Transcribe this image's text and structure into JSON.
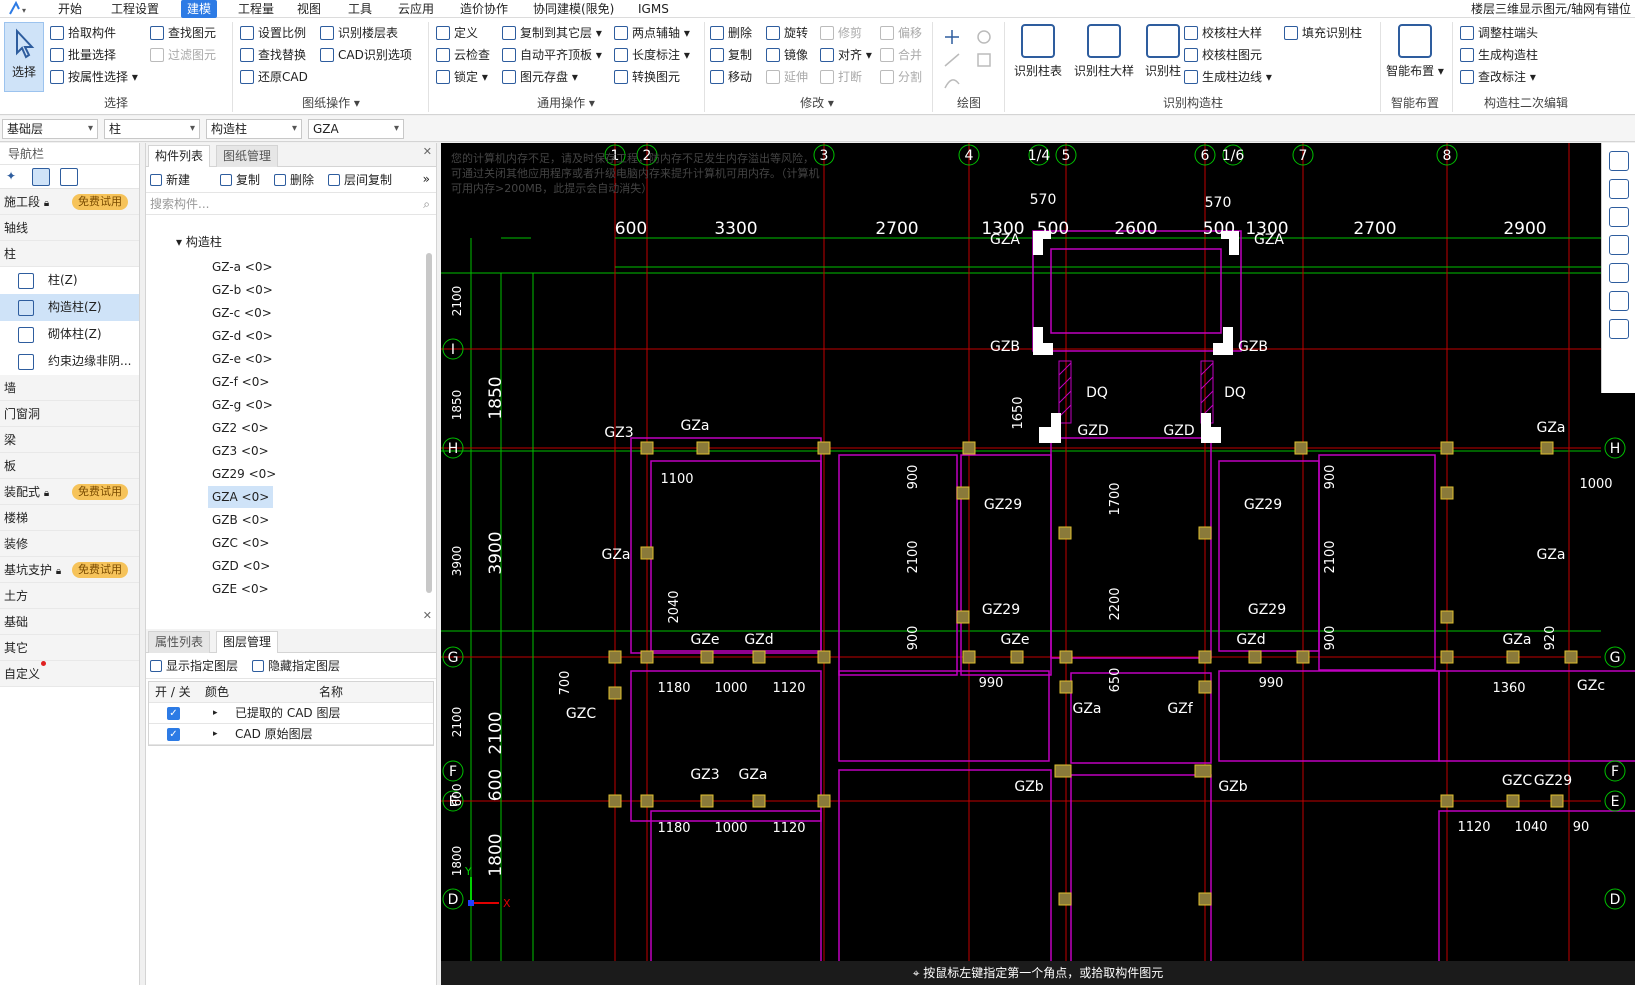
{
  "menu": {
    "items": [
      "开始",
      "工程设置",
      "建模",
      "工程量",
      "视图",
      "工具",
      "云应用",
      "造价协作",
      "协同建模(限免)",
      "IGMS"
    ],
    "active": "建模",
    "right_text": "楼层三维显示图元/轴网有错位"
  },
  "ribbon": {
    "select_big": "选择",
    "select_col1": [
      "拾取构件",
      "批量选择",
      "按属性选择"
    ],
    "select_col2": [
      "查找图元",
      "过滤图元"
    ],
    "select_label": "选择",
    "drawing_col1": [
      "设置比例",
      "查找替换",
      "还原CAD"
    ],
    "drawing_col2": [
      "识别楼层表",
      "CAD识别选项"
    ],
    "drawing_label": "图纸操作",
    "common_col1": [
      "定义",
      "云检查",
      "锁定"
    ],
    "common_col2": [
      "复制到其它层",
      "自动平齐顶板",
      "图元存盘"
    ],
    "common_col3": [
      "两点辅轴",
      "长度标注",
      "转换图元"
    ],
    "common_label": "通用操作",
    "modify_col1": [
      "删除",
      "复制",
      "移动"
    ],
    "modify_col2": [
      "旋转",
      "镜像",
      "延伸"
    ],
    "modify_col3": [
      "修剪",
      "对齐",
      "打断"
    ],
    "modify_col4": [
      "偏移",
      "合并",
      "分割"
    ],
    "modify_label": "修改",
    "draw_label": "绘图",
    "recognize_bigs": [
      "识别柱表",
      "识别柱大样",
      "识别柱"
    ],
    "recognize_col": [
      "校核柱大样",
      "校核柱图元",
      "生成柱边线"
    ],
    "recognize_col2": [
      "填充识别柱"
    ],
    "recognize_label": "识别构造柱",
    "smart_big": "智能布置",
    "smart_label": "智能布置",
    "edit_col": [
      "调整柱端头",
      "生成构造柱",
      "查改标注"
    ],
    "edit_label": "构造柱二次编辑"
  },
  "selectors": [
    "基础层",
    "柱",
    "构造柱",
    "GZA"
  ],
  "nav": {
    "title": "导航栏",
    "categories": [
      {
        "label": "施工段",
        "badge": "免费试用"
      },
      {
        "label": "轴线"
      },
      {
        "label": "柱"
      }
    ],
    "column_items": [
      "柱(Z)",
      "构造柱(Z)",
      "砌体柱(Z)",
      "约束边缘非阴..."
    ],
    "selected_item": "构造柱(Z)",
    "more_categories": [
      {
        "label": "墙"
      },
      {
        "label": "门窗洞"
      },
      {
        "label": "梁"
      },
      {
        "label": "板"
      },
      {
        "label": "装配式",
        "badge": "免费试用"
      },
      {
        "label": "楼梯"
      },
      {
        "label": "装修"
      },
      {
        "label": "基坑支护",
        "badge": "免费试用"
      },
      {
        "label": "土方"
      },
      {
        "label": "基础"
      },
      {
        "label": "其它"
      },
      {
        "label": "自定义",
        "dot": true
      }
    ]
  },
  "components": {
    "tabs": [
      "构件列表",
      "图纸管理"
    ],
    "toolbar": [
      "新建",
      "复制",
      "删除",
      "层间复制"
    ],
    "search_placeholder": "搜索构件...",
    "root": "构造柱",
    "items": [
      "GZ-a <0>",
      "GZ-b <0>",
      "GZ-c <0>",
      "GZ-d <0>",
      "GZ-e <0>",
      "GZ-f <0>",
      "GZ-g <0>",
      "GZ2 <0>",
      "GZ3 <0>",
      "GZ29 <0>",
      "GZA <0>",
      "GZB <0>",
      "GZC <0>",
      "GZD <0>",
      "GZE <0>"
    ],
    "selected": "GZA <0>"
  },
  "layers": {
    "tabs": [
      "属性列表",
      "图层管理"
    ],
    "toolbar": [
      "显示指定图层",
      "隐藏指定图层"
    ],
    "headers": [
      "开 / 关",
      "颜色",
      "名称"
    ],
    "rows": [
      "已提取的 CAD 图层",
      "CAD 原始图层"
    ]
  },
  "canvas": {
    "warning": "您的计算机内存不足，请及时保存工程，防内存不足发生内存溢出等风险，可通过关闭其他应用程序或者升级电脑内存来提升计算机可用内存。（计算机可用内存>200MB，此提示会自动消失）",
    "status": "按鼠标左键指定第一个角点，或拾取构件图元",
    "axis_top": [
      "1",
      "2",
      "3",
      "4",
      "1/4",
      "5",
      "6",
      "1/6",
      "7",
      "8"
    ],
    "axis_left": [
      "I",
      "H",
      "G",
      "F",
      "E",
      "D"
    ],
    "dims_top": [
      "600",
      "3300",
      "2700",
      "1300",
      "500",
      "2600",
      "500",
      "1300",
      "2700",
      "2900"
    ],
    "dims_small": [
      "570",
      "570"
    ],
    "dims_left": [
      "1850",
      "3900",
      "2100",
      "600",
      "1800"
    ],
    "dims_left_small": [
      "2100",
      "1850",
      "3900",
      "2100",
      "600",
      "1800"
    ],
    "labels": [
      "GZA",
      "GZA",
      "GZB",
      "GZB",
      "DQ",
      "DQ",
      "GZD",
      "GZD",
      "GZ3",
      "GZa",
      "GZa",
      "GZa",
      "GZa",
      "GZ29",
      "GZ29",
      "GZ29",
      "GZ29",
      "GZe",
      "GZd",
      "GZe",
      "GZd",
      "GZa",
      "GZa",
      "GZf",
      "GZb",
      "GZb",
      "GZC",
      "GZC",
      "GZ29",
      "GZc",
      "GZa",
      "GZ3"
    ],
    "dims_inner": [
      "1100",
      "2040",
      "900",
      "2100",
      "900",
      "1700",
      "2200",
      "650",
      "900",
      "2100",
      "900",
      "920",
      "1000",
      "1180",
      "1000",
      "1120",
      "990",
      "990",
      "1360",
      "1180",
      "1000",
      "1120",
      "1120",
      "1040",
      "90",
      "700",
      "1650"
    ]
  }
}
